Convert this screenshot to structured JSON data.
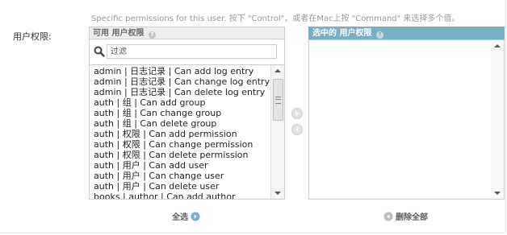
{
  "help_text": "Specific permissions for this user. 按下 \"Control\"，或者在Mac上按 \"Command\" 来选择多个值。",
  "field_label": "用户权限:",
  "available": {
    "title": "可用 用户权限",
    "filter_placeholder": "过滤",
    "options": [
      "admin | 日志记录 | Can add log entry",
      "admin | 日志记录 | Can change log entry",
      "admin | 日志记录 | Can delete log entry",
      "auth | 组 | Can add group",
      "auth | 组 | Can change group",
      "auth | 组 | Can delete group",
      "auth | 权限 | Can add permission",
      "auth | 权限 | Can change permission",
      "auth | 权限 | Can delete permission",
      "auth | 用户 | Can add user",
      "auth | 用户 | Can change user",
      "auth | 用户 | Can delete user",
      "books | author | Can add author"
    ],
    "choose_all_label": "全选"
  },
  "chosen": {
    "title": "选中的 用户权限",
    "options": [],
    "remove_all_label": "删除全部"
  },
  "colors": {
    "chosen_header": "#79aec8",
    "footer_icon": "#79aec8",
    "footer_icon_disabled": "#bcbcbc"
  },
  "icons": {
    "help": "question-circle-icon",
    "search": "search-icon",
    "add": "arrow-right-circle-icon",
    "remove": "arrow-left-circle-icon"
  }
}
